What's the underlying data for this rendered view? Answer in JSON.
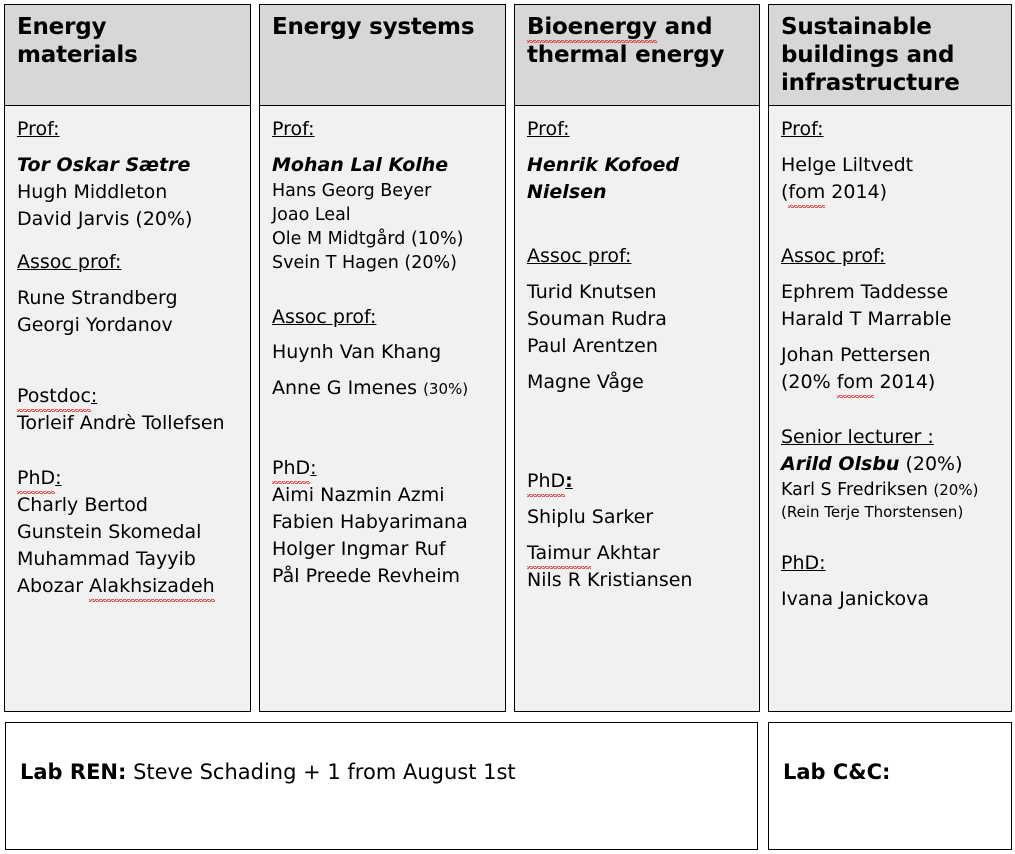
{
  "colors": {
    "header_bg": "#d7d7d7",
    "card_bg": "#f1f1f1",
    "lab_bg": "#ffffff",
    "border": "#000000",
    "spellcheck": "#e02020"
  },
  "columns": [
    {
      "title": "Energy materials",
      "title_lines": [
        "Energy",
        "materials"
      ],
      "sections": [
        {
          "label": "Prof:",
          "people": [
            {
              "name": "Tor Oskar Sætre",
              "style": "bold-italic"
            },
            {
              "name": "Hugh Middleton",
              "style": "regular"
            },
            {
              "name": "David Jarvis (20%)",
              "style": "regular"
            }
          ]
        },
        {
          "label": "Assoc prof:",
          "people": [
            {
              "name": "Rune Strandberg",
              "style": "regular"
            },
            {
              "name": "Georgi Yordanov",
              "style": "regular"
            }
          ]
        },
        {
          "label": "Postdoc:",
          "label_spellcheck": "Postdoc",
          "people": [
            {
              "name": "Torleif Andrè Tollefsen",
              "style": "regular"
            }
          ]
        },
        {
          "label": "PhD:",
          "label_spellcheck": "PhD",
          "people": [
            {
              "name": "Charly Bertod",
              "style": "regular"
            },
            {
              "name": "Gunstein Skomedal",
              "style": "regular"
            },
            {
              "name": "Muhammad Tayyib",
              "style": "regular"
            },
            {
              "name": "Abozar Alakhsizadeh",
              "style": "regular",
              "spellcheck": "Alakhsizadeh"
            }
          ]
        }
      ]
    },
    {
      "title": "Energy systems",
      "title_lines": [
        "Energy systems"
      ],
      "sections": [
        {
          "label": "Prof:",
          "people": [
            {
              "name": "Mohan Lal Kolhe",
              "style": "bold-italic"
            },
            {
              "name": "Hans Georg Beyer",
              "style": "small"
            },
            {
              "name": "Joao Leal",
              "style": "small"
            },
            {
              "name": "Ole M Midtgård (10%)",
              "style": "small"
            },
            {
              "name": "Svein T Hagen (20%)",
              "style": "small"
            }
          ]
        },
        {
          "label": "Assoc prof:",
          "people": [
            {
              "name": "Huynh Van Khang",
              "style": "regular"
            },
            {
              "name": "Anne G Imenes",
              "suffix": "(30%)",
              "style": "regular"
            }
          ]
        },
        {
          "label": "PhD:",
          "label_spellcheck": "PhD",
          "people": [
            {
              "name": "Aimi Nazmin Azmi",
              "style": "regular"
            },
            {
              "name": "Fabien Habyarimana",
              "style": "regular"
            },
            {
              "name": "Holger Ingmar Ruf",
              "style": "regular"
            },
            {
              "name": "Pål Preede Revheim",
              "style": "regular"
            }
          ]
        }
      ]
    },
    {
      "title": "Bioenergy and thermal energy",
      "title_lines": [
        "Bioenergy and",
        "thermal energy"
      ],
      "title_spellcheck": "Bioenergy",
      "sections": [
        {
          "label": "Prof:",
          "people": [
            {
              "name": "Henrik Kofoed Nielsen",
              "style": "bold-italic",
              "lines": [
                "Henrik Kofoed",
                "Nielsen"
              ]
            }
          ]
        },
        {
          "label": "Assoc prof:",
          "people": [
            {
              "name": "Turid Knutsen",
              "style": "regular"
            },
            {
              "name": "Souman Rudra",
              "style": "regular"
            },
            {
              "name": "Paul Arentzen",
              "style": "regular"
            },
            {
              "name": "Magne Våge",
              "style": "regular"
            }
          ]
        },
        {
          "label": "PhD:",
          "label_spellcheck": "PhD",
          "label_bold_colon": true,
          "people": [
            {
              "name": "Shiplu Sarker",
              "style": "regular"
            },
            {
              "name": "Taimur Akhtar",
              "style": "regular",
              "spellcheck": "Taimur"
            },
            {
              "name": "Nils R Kristiansen",
              "style": "regular"
            }
          ]
        }
      ]
    },
    {
      "title": "Sustainable buildings and infrastructure",
      "title_lines": [
        "Sustainable",
        "buildings and",
        "infrastructure"
      ],
      "sections": [
        {
          "label": "Prof:",
          "people": [
            {
              "name": "Helge Liltvedt",
              "style": "regular"
            },
            {
              "name": "(fom 2014)",
              "style": "regular",
              "spellcheck": "fom"
            }
          ]
        },
        {
          "label": "Assoc prof:",
          "people": [
            {
              "name": "Ephrem Taddesse",
              "style": "regular"
            },
            {
              "name": "Harald T Marrable",
              "style": "regular"
            },
            {
              "name": "Johan Pettersen",
              "style": "regular"
            },
            {
              "name": "(20% fom 2014)",
              "style": "regular",
              "spellcheck": "fom"
            }
          ]
        },
        {
          "label": "Senior lecturer :",
          "people": [
            {
              "name": "Arild Olsbu",
              "suffix_plain": " (20%)",
              "style": "bold-italic"
            },
            {
              "name": "Karl S Fredriksen",
              "suffix": "(20%)",
              "style": "small"
            },
            {
              "name": "(Rein Terje Thorstensen)",
              "style": "xsmall"
            }
          ]
        },
        {
          "label": "PhD:",
          "people": [
            {
              "name": "Ivana Janickova",
              "style": "regular"
            }
          ]
        }
      ]
    }
  ],
  "labs": [
    {
      "label": "Lab REN:",
      "text": " Steve Schading + 1 from August 1st"
    },
    {
      "label": "Lab C&C:",
      "text": ""
    }
  ]
}
